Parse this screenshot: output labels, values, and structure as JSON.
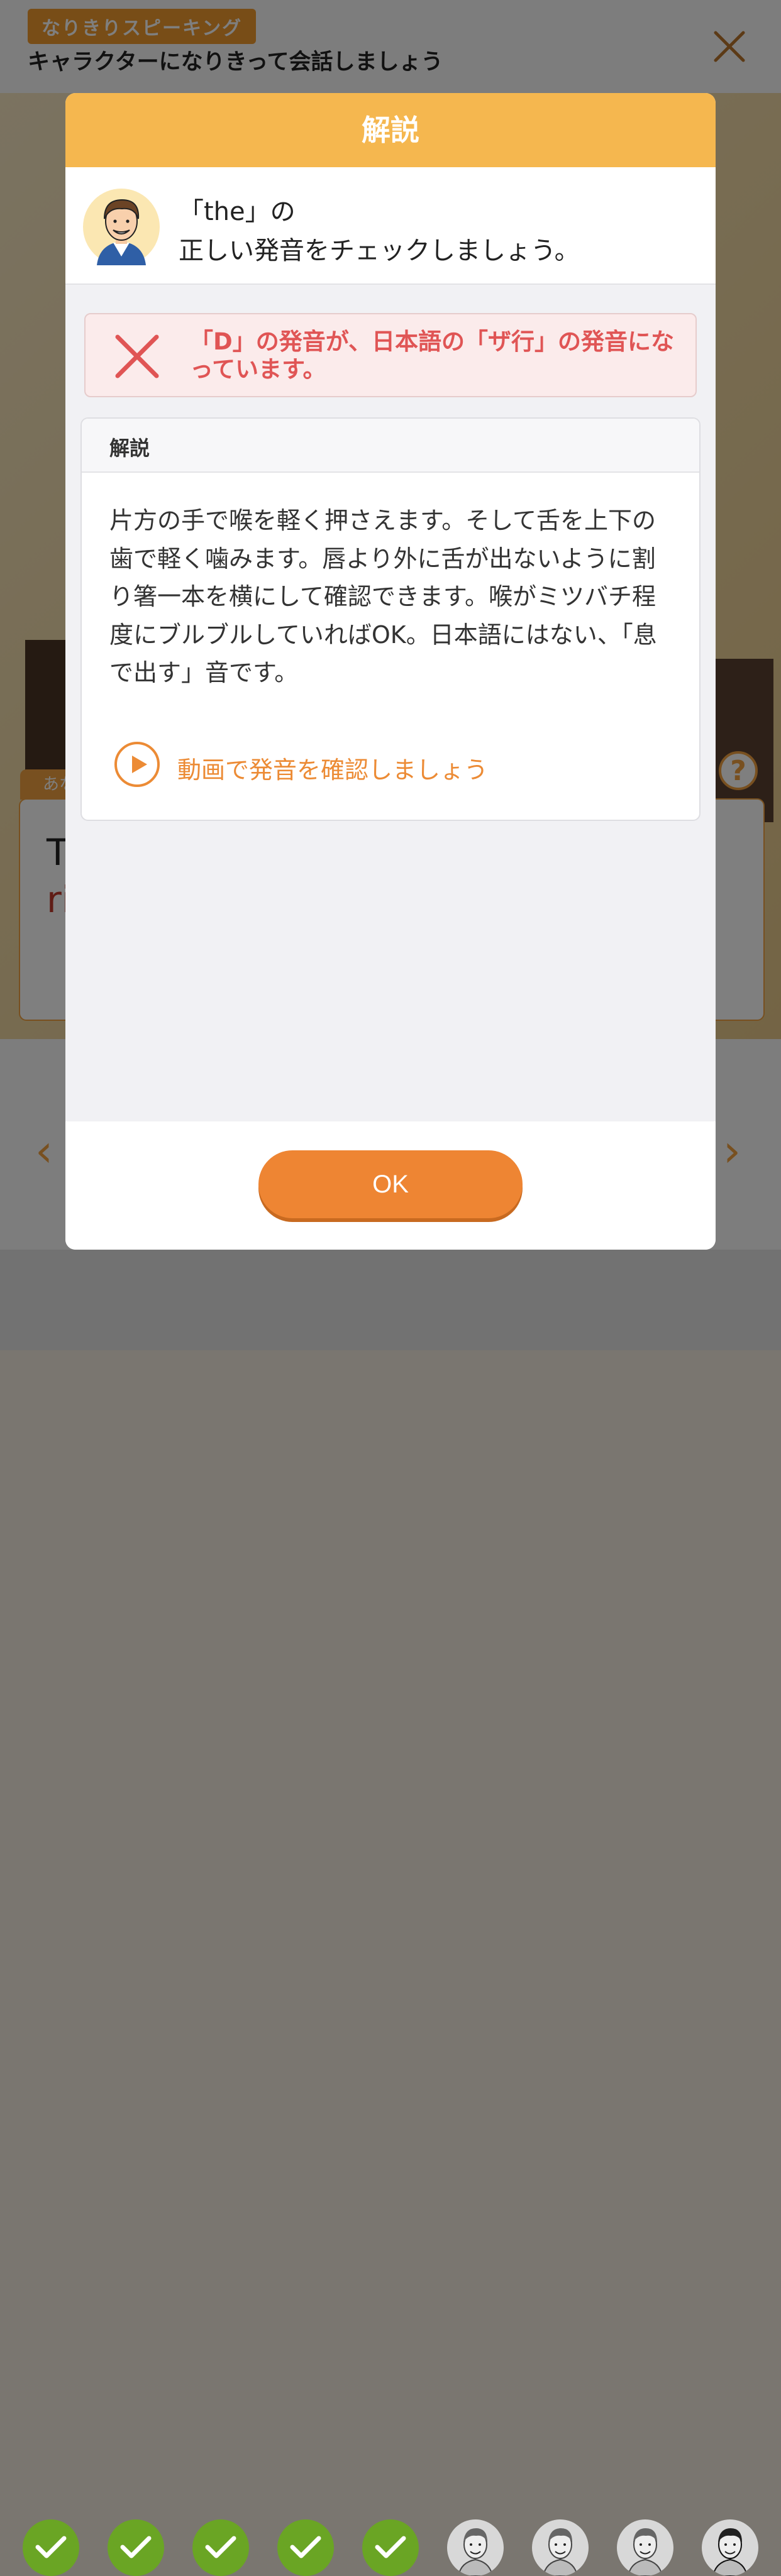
{
  "app": {
    "tag": "なりきりスピーキング",
    "title": "キャラクターになりきって会話しましょう"
  },
  "background": {
    "card_tab": "あな",
    "card_line1": "T",
    "card_line2": "ri",
    "help": "?",
    "prev": "‹",
    "next": "›"
  },
  "progress": [
    {
      "state": "done"
    },
    {
      "state": "done"
    },
    {
      "state": "done"
    },
    {
      "state": "done"
    },
    {
      "state": "done"
    },
    {
      "state": "pending"
    },
    {
      "state": "pending"
    },
    {
      "state": "pending"
    },
    {
      "state": "current"
    }
  ],
  "modal": {
    "title": "解説",
    "intro_line1": "「the」の",
    "intro_line2": "正しい発音をチェックしましょう。",
    "error_text": "「D」の発音が、日本語の「ザ行」の発音になっています。",
    "panel_title": "解説",
    "explanation": "片方の手で喉を軽く押さえます。そして舌を上下の歯で軽く噛みます。唇より外に舌が出ないように割り箸一本を横にして確認できます。喉がミツバチ程度にブルブルしていればOK。日本語にはない、「息で出す」音です。",
    "video_link": "動画で発音を確認しましょう",
    "ok_label": "OK"
  },
  "colors": {
    "accent": "#ee8533",
    "header": "#f5b74f",
    "error": "#e05555",
    "done": "#6aa524"
  }
}
